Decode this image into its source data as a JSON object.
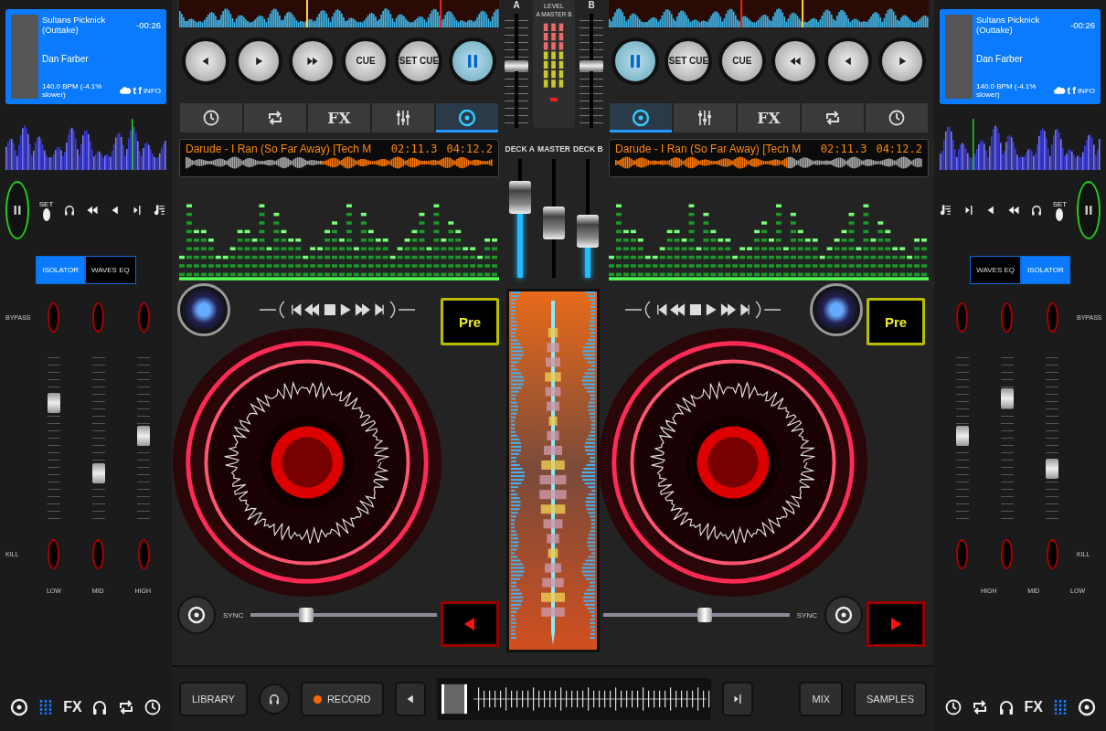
{
  "side_panels": [
    {
      "track": {
        "title": "Sultans Picknick (Outtake)",
        "time": "-00:26",
        "artist": "Dan Farber",
        "bpm": "140.0 BPM (-4.1% slower)",
        "links": [
          "t",
          "f"
        ],
        "info": "INFO"
      },
      "controls": [
        {
          "kind": "pause"
        },
        {
          "kind": "set",
          "label": "SET"
        },
        {
          "kind": "headphones"
        },
        {
          "kind": "rewind"
        },
        {
          "kind": "previous"
        },
        {
          "kind": "next"
        },
        {
          "kind": "playlist"
        }
      ],
      "eq_tabs": [
        {
          "label": "ISOLATOR",
          "selected": true
        },
        {
          "label": "WAVES EQ",
          "selected": false
        }
      ],
      "bypass_label": "BYPASS",
      "kill_label": "KILL",
      "bands": [
        {
          "label": "LOW",
          "level": 0.72
        },
        {
          "label": "MID",
          "level": 0.25
        },
        {
          "label": "HIGH",
          "level": 0.5
        }
      ],
      "tools": [
        {
          "kind": "disc",
          "selected": false
        },
        {
          "kind": "equalizer",
          "selected": true
        },
        {
          "kind": "fx",
          "label": "FX",
          "selected": false
        },
        {
          "kind": "headphones",
          "selected": false
        },
        {
          "kind": "loop",
          "selected": false
        },
        {
          "kind": "clock",
          "selected": false
        }
      ]
    },
    {
      "track": {
        "title": "Sultans Picknick (Outtake)",
        "time": "-00:26",
        "artist": "Dan Farber",
        "bpm": "140.0 BPM (-4.1% slower)",
        "links": [
          "t",
          "f"
        ],
        "info": "INFO"
      },
      "controls": [
        {
          "kind": "playlist"
        },
        {
          "kind": "next"
        },
        {
          "kind": "previous"
        },
        {
          "kind": "rewind"
        },
        {
          "kind": "headphones"
        },
        {
          "kind": "set",
          "label": "SET"
        },
        {
          "kind": "pause"
        }
      ],
      "eq_tabs": [
        {
          "label": "WAVES EQ",
          "selected": false
        },
        {
          "label": "ISOLATOR",
          "selected": true
        }
      ],
      "bypass_label": "BYPASS",
      "kill_label": "KILL",
      "bands": [
        {
          "label": "HIGH",
          "level": 0.5
        },
        {
          "label": "MID",
          "level": 0.75
        },
        {
          "label": "LOW",
          "level": 0.28
        }
      ],
      "tools": [
        {
          "kind": "clock",
          "selected": false
        },
        {
          "kind": "loop",
          "selected": false
        },
        {
          "kind": "headphones",
          "selected": false
        },
        {
          "kind": "fx",
          "label": "FX",
          "selected": false
        },
        {
          "kind": "equalizer",
          "selected": true
        },
        {
          "kind": "disc",
          "selected": false
        }
      ]
    }
  ],
  "decks": [
    {
      "transport": [
        {
          "kind": "previous"
        },
        {
          "kind": "play"
        },
        {
          "kind": "forward"
        },
        {
          "kind": "text",
          "label": "CUE"
        },
        {
          "kind": "text",
          "label": "SET CUE"
        },
        {
          "kind": "pause"
        }
      ],
      "tabs": [
        {
          "kind": "clock",
          "selected": false
        },
        {
          "kind": "loop",
          "selected": false
        },
        {
          "kind": "fx",
          "label": "FX",
          "selected": false
        },
        {
          "kind": "sliders",
          "selected": false
        },
        {
          "kind": "disc",
          "selected": true
        }
      ],
      "display": {
        "title": "Darude - I Ran (So Far Away) [Tech M",
        "elapsed": "02:11.3",
        "remaining": "04:12.2"
      },
      "pre_label": "Pre",
      "pitch": {
        "label": "SYNC",
        "level": 0.28
      }
    },
    {
      "transport": [
        {
          "kind": "pause"
        },
        {
          "kind": "text",
          "label": "SET CUE"
        },
        {
          "kind": "text",
          "label": "CUE"
        },
        {
          "kind": "rewind"
        },
        {
          "kind": "previous"
        },
        {
          "kind": "play"
        }
      ],
      "tabs": [
        {
          "kind": "disc",
          "selected": true
        },
        {
          "kind": "sliders",
          "selected": false
        },
        {
          "kind": "fx",
          "label": "FX",
          "selected": false
        },
        {
          "kind": "loop",
          "selected": false
        },
        {
          "kind": "clock",
          "selected": false
        }
      ],
      "display": {
        "title": "Darude - I Ran (So Far Away) [Tech M",
        "elapsed": "02:11.3",
        "remaining": "04:12.2"
      },
      "pre_label": "Pre",
      "pitch": {
        "label": "SYNC",
        "level": 0.55
      }
    }
  ],
  "mixer": {
    "channels": [
      {
        "label": "A",
        "level": 0.55
      },
      {
        "label": "B",
        "level": 0.55
      }
    ],
    "meter": {
      "title": "LEVEL",
      "subtitle": "A MASTER B"
    },
    "faders": [
      {
        "label": "DECK A",
        "level": 0.75
      },
      {
        "label": "MASTER",
        "level": 0.45
      },
      {
        "label": "DECK B",
        "level": 0.35
      }
    ]
  },
  "bottom_bar": {
    "library": "LIBRARY",
    "record": "RECORD",
    "mix": "MIX",
    "samples": "SAMPLES"
  }
}
